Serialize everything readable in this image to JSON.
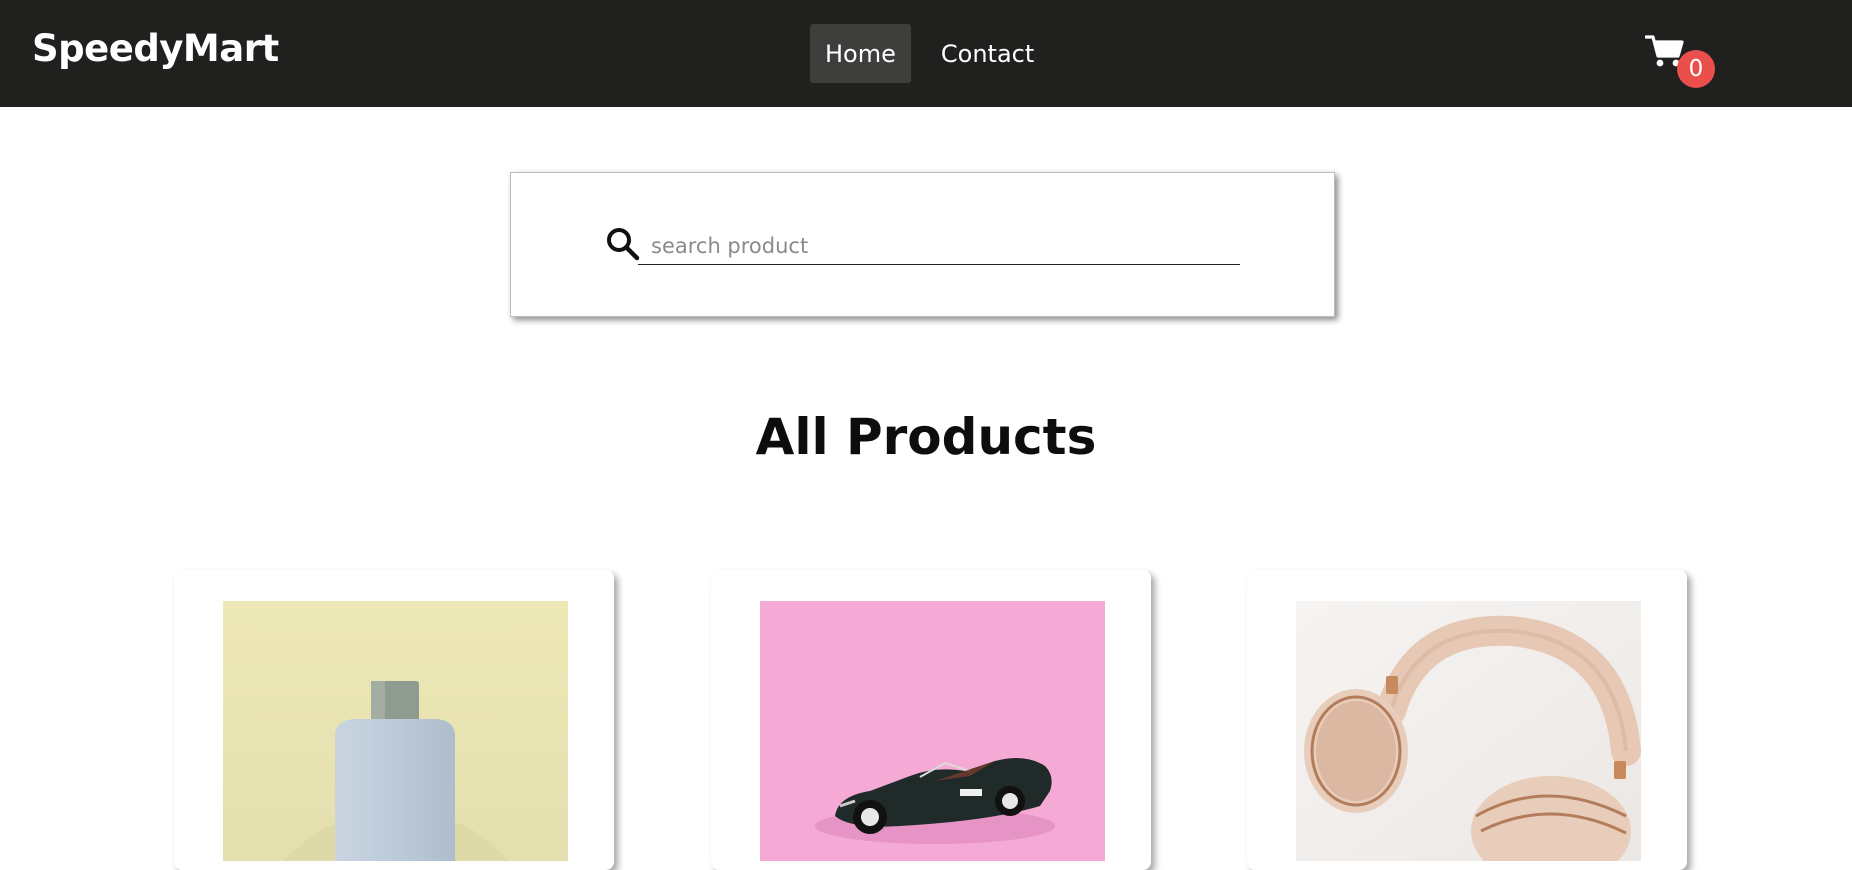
{
  "header": {
    "brand": "SpeedyMart",
    "nav": [
      {
        "label": "Home",
        "active": true
      },
      {
        "label": "Contact",
        "active": false
      }
    ],
    "cart": {
      "icon": "cart-icon",
      "count": "0",
      "badge_color": "#ea4f4c"
    },
    "background_color": "#20201e"
  },
  "search": {
    "icon": "search-icon",
    "placeholder": "search product",
    "value": ""
  },
  "main": {
    "title": "All Products",
    "products": [
      {
        "image": "perfume-bottle-image",
        "image_bg": "#ece6b3"
      },
      {
        "image": "toy-car-image",
        "image_bg": "#f5a8d4"
      },
      {
        "image": "headphones-image",
        "image_bg": "#f2efee"
      }
    ]
  }
}
